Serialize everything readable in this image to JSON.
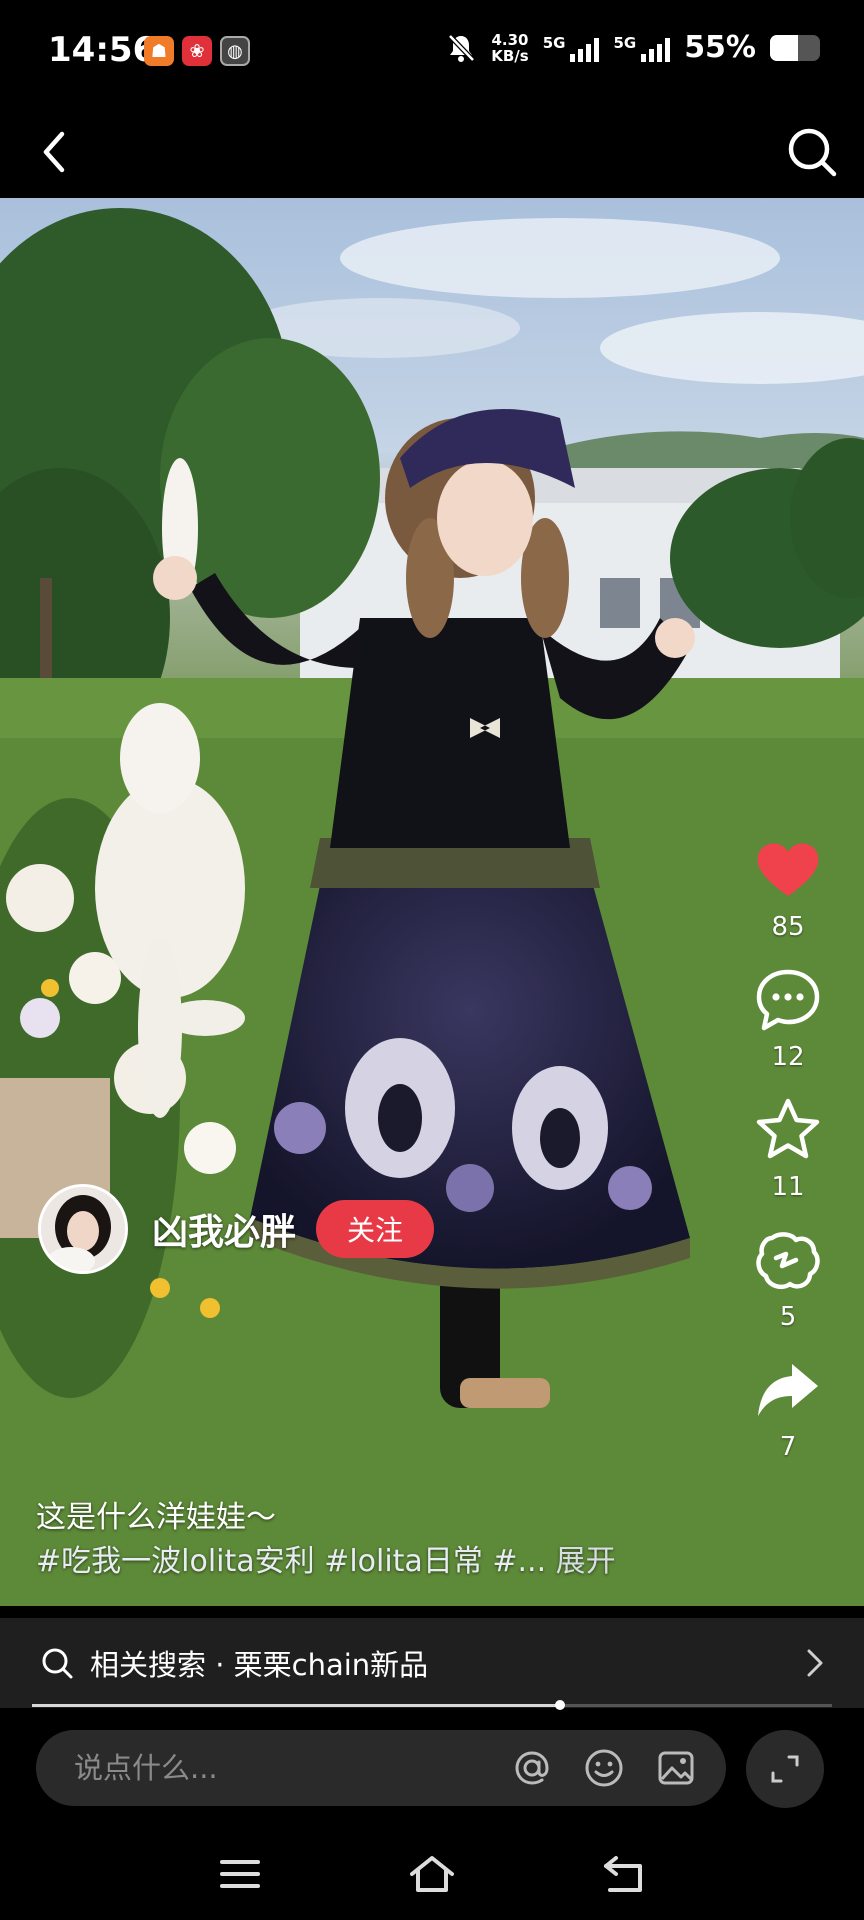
{
  "status_bar": {
    "time": "14:56",
    "net_speed_value": "4.30",
    "net_speed_unit": "KB/s",
    "sim1": "5G",
    "sim2": "5G",
    "battery": "55%",
    "battery_level": 0.55,
    "app_icons": [
      "orange-app-icon",
      "red-app-icon",
      "gray-app-icon"
    ]
  },
  "topbar": {
    "back_icon": "chevron-left-icon",
    "search_icon": "search-icon"
  },
  "actions": {
    "like_count": "85",
    "comment_count": "12",
    "favorite_count": "11",
    "share_wechat_count": "5",
    "share_count": "7",
    "like_color": "#f0424d"
  },
  "author": {
    "name": "凶我必胖",
    "follow_label": "关注",
    "follow_color": "#e83a46"
  },
  "post": {
    "caption": "这是什么洋娃娃～",
    "tags": "#吃我一波lolita安利 #lolita日常 #...",
    "expand_label": "展开"
  },
  "related_search": {
    "text": "相关搜索 · 栗栗chain新品"
  },
  "video_progress": 0.66,
  "comment": {
    "placeholder": "说点什么..."
  },
  "navbar": {
    "icons": [
      "menu-icon",
      "home-icon",
      "back-icon"
    ]
  }
}
